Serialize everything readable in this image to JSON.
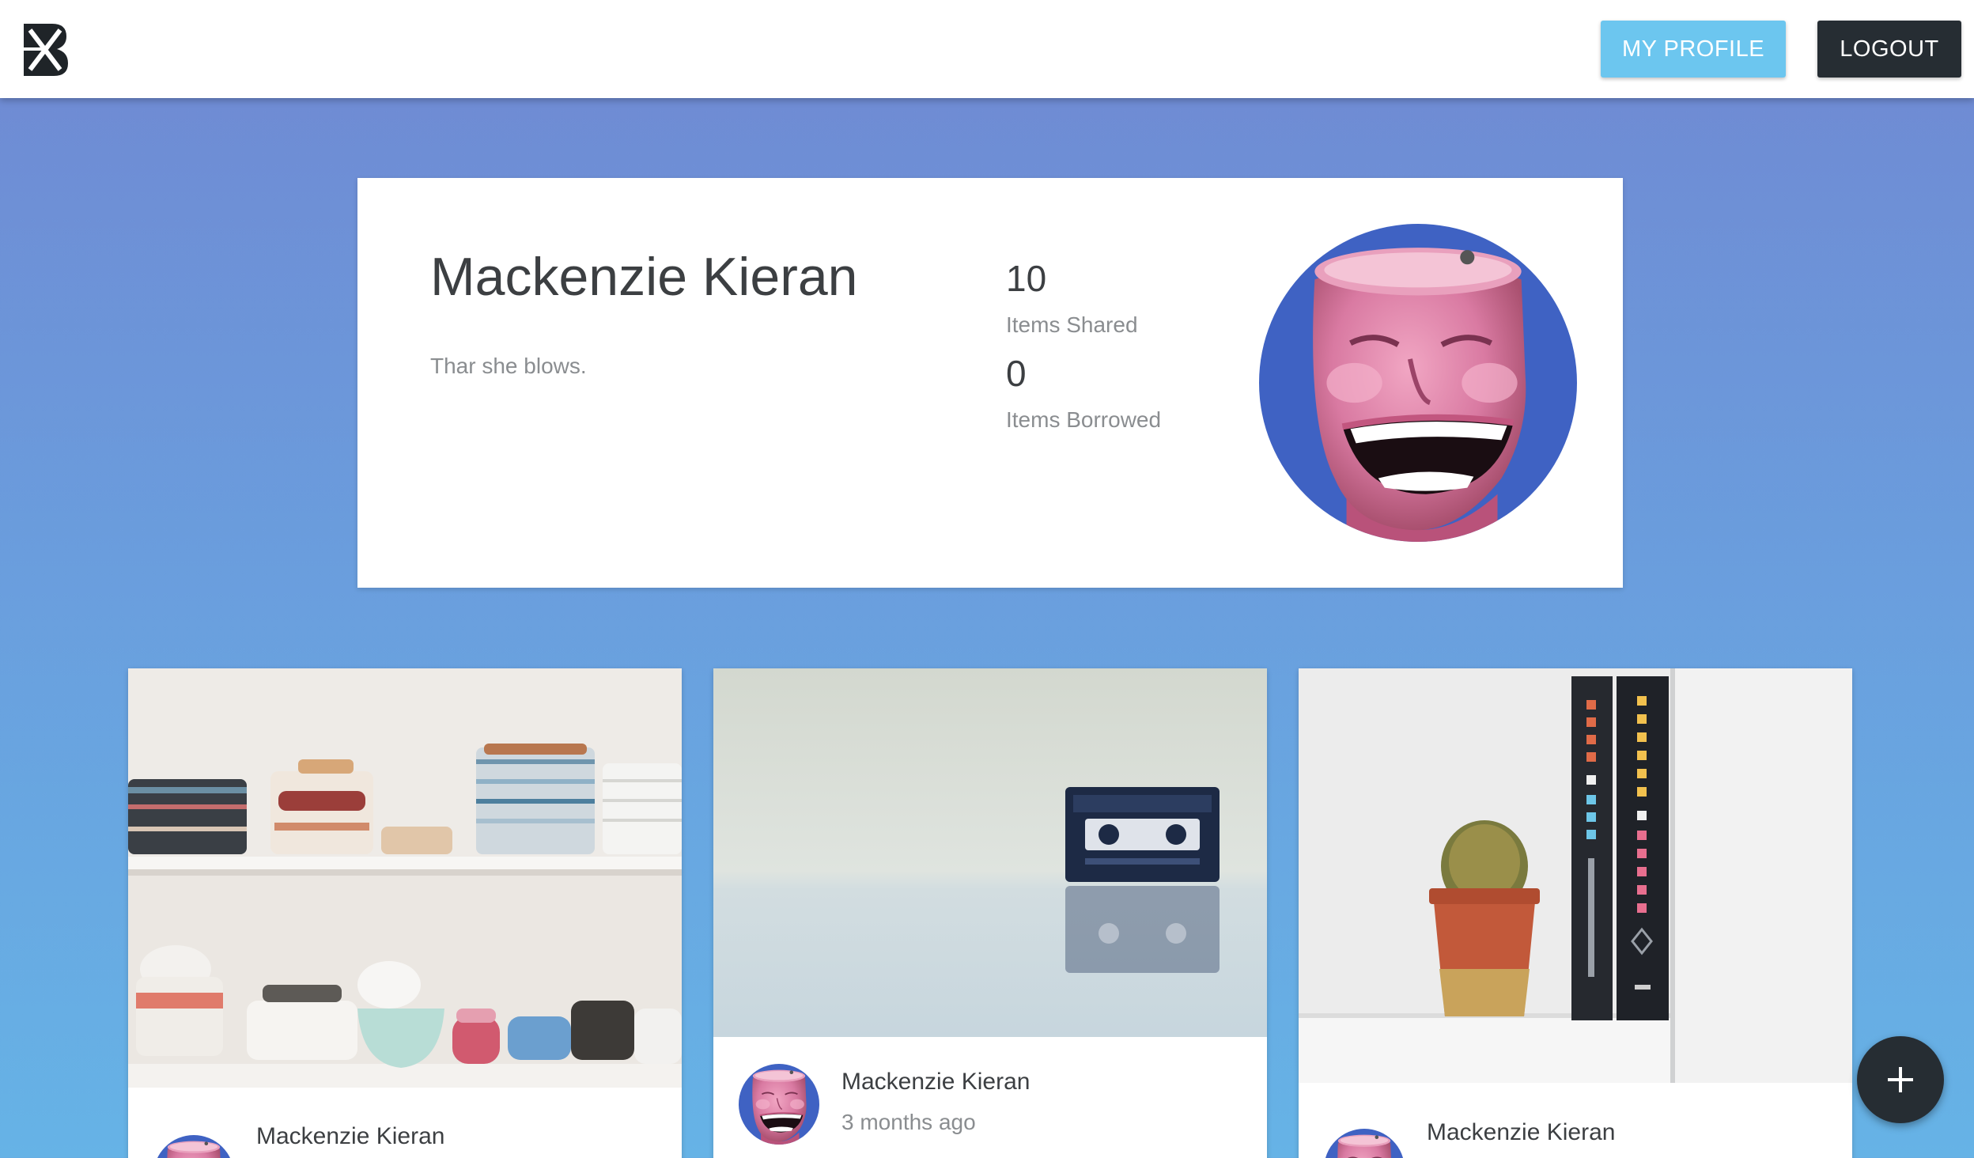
{
  "header": {
    "logo_icon": "boomtown-logo-icon",
    "my_profile_label": "MY PROFILE",
    "logout_label": "LOGOUT"
  },
  "profile": {
    "name": "Mackenzie Kieran",
    "bio": "Thar she blows.",
    "stats": [
      {
        "value": "10",
        "label": "Items Shared"
      },
      {
        "value": "0",
        "label": "Items Borrowed"
      }
    ],
    "avatar_icon": "laughing-face-avatar"
  },
  "items": [
    {
      "image": "stacked-plates-and-bowls",
      "owner": "Mackenzie Kieran",
      "time": ""
    },
    {
      "image": "cassette-tape",
      "owner": "Mackenzie Kieran",
      "time": "3 months ago"
    },
    {
      "image": "cactus-and-books",
      "owner": "Mackenzie Kieran",
      "time": ""
    }
  ],
  "fab": {
    "icon": "plus-icon"
  },
  "colors": {
    "primary_button": "#6cc6ef",
    "dark_button": "#262d33",
    "gradient_top": "#7088d2",
    "gradient_bottom": "#66b3e6"
  }
}
